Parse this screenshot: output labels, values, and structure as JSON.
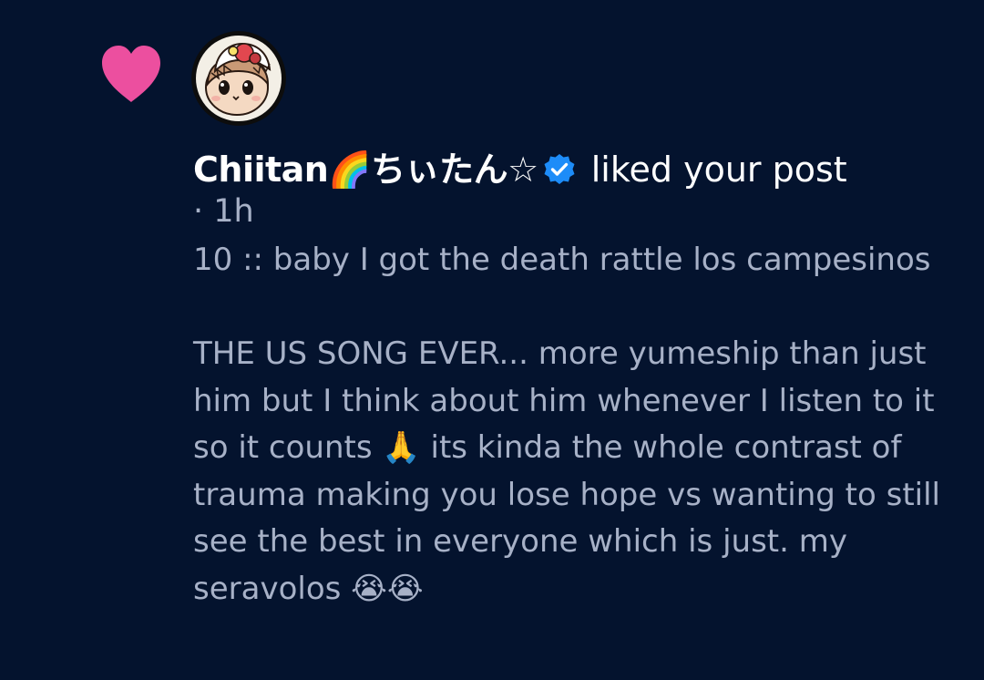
{
  "notification": {
    "type_icon": "heart-icon",
    "avatar": "avatar-illustration",
    "actor_name": "Chiitan🌈ちぃたん☆",
    "verified_icon": "verified-check-icon",
    "action_text": "liked your post",
    "time_text": "· 1h",
    "post_excerpt": "10 :: baby I got the death rattle los campesinos\n\nTHE US SONG EVER... more yumeship than just him but I think about him whenever I listen to it so it counts 🙏 its kinda the whole contrast of trauma making you lose hope vs wanting to still see the best in everyone which is just. my seravolos 😭😭"
  },
  "colors": {
    "background": "#04132e",
    "heart": "#ec4f9f",
    "name": "#ffffff",
    "body_text": "#a7b1c7",
    "verified": "#1d8cf8"
  }
}
